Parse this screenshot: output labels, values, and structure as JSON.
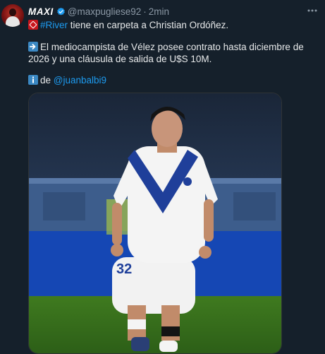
{
  "author": {
    "display_name": "MAXI",
    "handle": "@maxpugliese92",
    "separator": "·",
    "time": "2min",
    "verified": true,
    "avatar_icon": "avatar-image"
  },
  "tweet": {
    "line1": {
      "hashtag": "#River",
      "text": " tiene en carpeta a Christian Ordóñez."
    },
    "line2": {
      "text": "El mediocampista de Vélez posee contrato hasta diciembre de 2026 y una cláusula de salida de U$S 10M."
    },
    "line3": {
      "prefix": "de",
      "mention": "@juanbalbi9"
    }
  },
  "media": {
    "alt_icon": "soccer-player-photo",
    "jersey_number": "32"
  },
  "colors": {
    "background": "#15202b",
    "text": "#e7e9ea",
    "muted": "#8b98a5",
    "link": "#1d9bf0"
  }
}
